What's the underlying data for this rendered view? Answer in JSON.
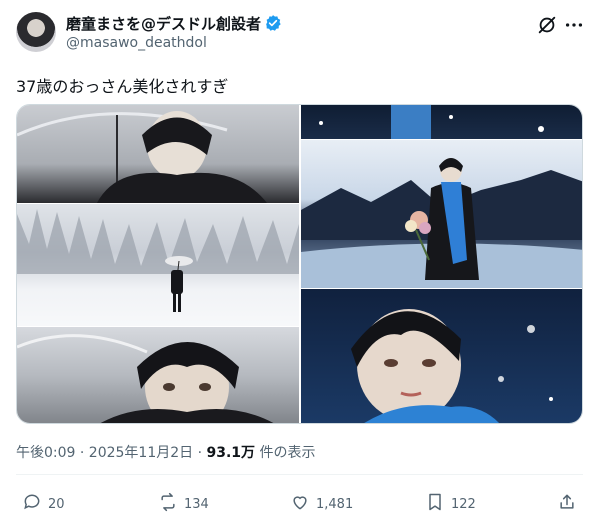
{
  "author": {
    "display_name": "磨童まさを@デスドル創設者",
    "handle": "@masawo_deathdol"
  },
  "post_text": "37歳のおっさん美化されすぎ",
  "timestamp": "午後0:09 · 2025年11月2日",
  "views": {
    "count": "93.1万",
    "label": "件の表示"
  },
  "actions": {
    "replies": "20",
    "reposts": "134",
    "likes": "1,481",
    "bookmarks": "122"
  },
  "icons": [
    "avatar",
    "verified-badge-icon",
    "grok-icon",
    "more-icon",
    "reply-icon",
    "repost-icon",
    "like-icon",
    "bookmark-icon",
    "share-icon"
  ],
  "colors": {
    "accent": "#1d9bf0",
    "muted": "#536471",
    "text": "#0f1419"
  }
}
